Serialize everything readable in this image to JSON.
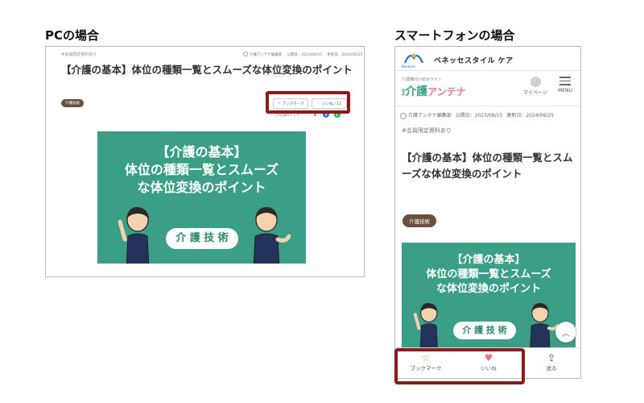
{
  "pc": {
    "heading": "PCの場合",
    "tag": "#会員限定資料あり",
    "author": "介護アンテナ編集部",
    "published": "公開日：2023/08/15",
    "updated": "更新日：2024/06/25",
    "title": "【介護の基本】体位の種類一覧とスムーズな体位変換のポイント",
    "category": "介護技術",
    "bookmark_label": "ブックマーク",
    "like_label": "いいね / 12",
    "share_text": "この記事をシェア"
  },
  "banner": {
    "line1": "【介護の基本】",
    "line2": "体位の種類一覧とスムーズ",
    "line3": "な体位変換のポイント",
    "pill": "介 護 技 術"
  },
  "sp": {
    "heading": "スマートフォンの場合",
    "brand": "ベネッセスタイル ケア",
    "logo_caption": "Benesse",
    "site_sub": "介護職向け総合サイト",
    "site_name_a": "介護",
    "site_name_b": "アンテナ",
    "mypage": "マイページ",
    "menu": "MENU",
    "author": "介護アンテナ編集部",
    "published": "公開日：2023/08/15",
    "updated": "更新日：2024/06/25",
    "tag": "#会員限定資料あり",
    "title": "【介護の基本】体位の種類一覧とスムーズな体位変換のポイント",
    "category": "介護技術",
    "bottom": {
      "bookmark": "ブックマーク",
      "like": "いいね",
      "send": "送る"
    }
  },
  "colors": {
    "accent_green": "#3a9f86",
    "highlight": "#8b1a1a",
    "category_bg": "#6a4f3e",
    "like_pink": "#e07a86"
  }
}
